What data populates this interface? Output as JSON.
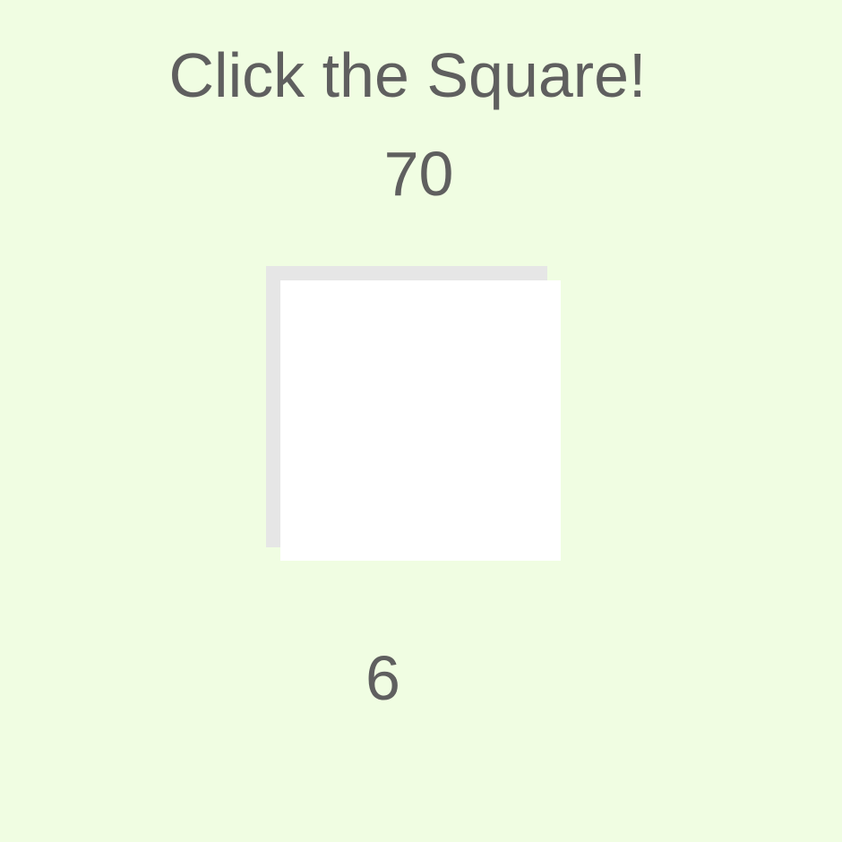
{
  "game": {
    "title": "Click the Square!",
    "score": "70",
    "counter": "6",
    "colors": {
      "background": "#f0fde2",
      "square": "#ffffff",
      "square_shadow": "#e6e6e6",
      "text": "#5f5f5f"
    }
  }
}
